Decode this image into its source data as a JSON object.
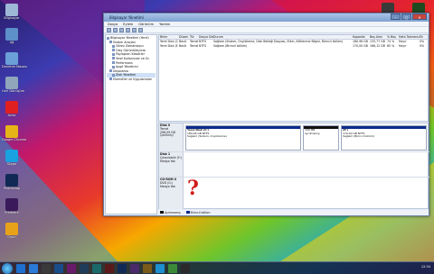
{
  "desktop": {
    "icons": [
      {
        "label": "Bilgisayar",
        "color": "#9db7d6"
      },
      {
        "label": "Ağ",
        "color": "#5d8fc9"
      },
      {
        "label": "Denetim Masası",
        "color": "#6a9fd8"
      },
      {
        "label": "Geri Dönüşüm",
        "color": "#8fa6bb"
      },
      {
        "label": "Avira",
        "color": "#e02020"
      },
      {
        "label": "Google Chrome",
        "color": "#e7b418"
      },
      {
        "label": "Skype",
        "color": "#1aa1e0"
      },
      {
        "label": "Photoshop",
        "color": "#102a55"
      },
      {
        "label": "Premiere",
        "color": "#3a1a5a"
      },
      {
        "label": "Oyun",
        "color": "#e8a21a"
      }
    ],
    "right_icons": [
      {
        "label": "Yeni Klasör",
        "color": "#3a3a3a"
      },
      {
        "label": "Oyun",
        "color": "#1f4a1f"
      }
    ]
  },
  "window": {
    "title": "Bilgisayar Yönetimi",
    "menu": [
      "Dosya",
      "Eylem",
      "Görünüm",
      "Yardım"
    ],
    "tree": [
      "Bilgisayar Yönetimi (Yerel)",
      "Sistem Araçları",
      "Görev Zamanlayıcı",
      "Olay Görüntüleyicisi",
      "Paylaşılan Klasörler",
      "Yerel Kullanıcılar ve Gr.",
      "Performans",
      "Aygıt Yöneticisi",
      "Depolama",
      "Disk Yönetimi",
      "Hizmetler ve Uygulamalar"
    ],
    "table": {
      "headers": [
        "Birim",
        "Düzen",
        "Tür",
        "Dosya Sistemi",
        "Durum",
        "Kapasite",
        "Boş Alan",
        "% Boş",
        "Hata Toleransı",
        "Ek"
      ],
      "rows": [
        [
          "Yerel Disk (C:)",
          "Basit",
          "Temel",
          "NTFS",
          "Sağlam (Sistem, Önyükleme, Disk Belleği Dosyası, Etkin, Kilitlenme Bilgisi, Birincil bölüm)",
          "180,96 GB",
          "133,77 GB",
          "74 %",
          "Hayır",
          "0%"
        ],
        [
          "Yerel Disk (E:)",
          "Basit",
          "Temel",
          "NTFS",
          "Sağlam (Birincil bölüm)",
          "170,00 GB",
          "166,12 GB",
          "85 %",
          "Hayır",
          "0%"
        ]
      ]
    },
    "disks": [
      {
        "name": "Disk 0",
        "info": [
          "Temel",
          "298,09 GB",
          "Çevrimiçi"
        ],
        "parts": [
          {
            "title": "Yerel Disk (C:)",
            "size": "180,96 GB NTFS",
            "status": "Sağlam (Sistem, Önyükleme)"
          },
          {
            "title": "",
            "size": "100 MB",
            "status": "Ayrılmamış"
          },
          {
            "title": "(E:)",
            "size": "170,00 GB NTFS",
            "status": "Sağlam (Birincil bölüm)"
          }
        ]
      },
      {
        "name": "Disk 1",
        "info": [
          "Çıkarılabilir (F:)",
          "",
          "Medya Yok"
        ]
      },
      {
        "name": "CD-ROM 0",
        "info": [
          "DVD (G:)",
          "",
          "Medya Yok"
        ]
      }
    ],
    "question_mark": "?",
    "legend": [
      "Ayrılmamış",
      "Birincil bölüm"
    ]
  },
  "taskbar": {
    "time": "12:34",
    "apps": [
      "#1e6fd0",
      "#2a7ad8",
      "#3a3a3a",
      "#1a4c8a",
      "#6a1a6a",
      "#1f3d5a",
      "#1a6a6a",
      "#5a1a1a",
      "#102a55",
      "#4a2a6a",
      "#7a5a1a",
      "#1e8fd0",
      "#3a8a3a",
      "#2a2a2a"
    ]
  }
}
